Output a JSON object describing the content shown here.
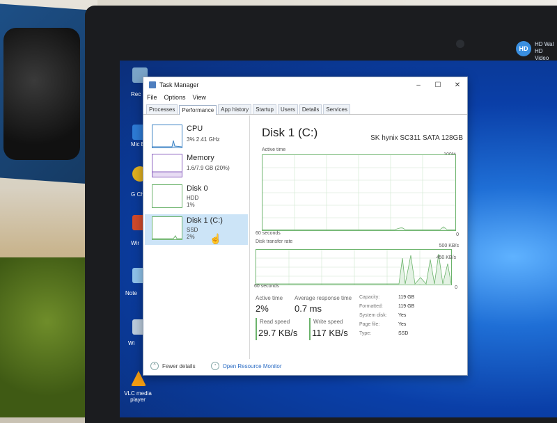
{
  "desktop": {
    "badge": "HD",
    "badge_text": "HD Wal HD Video",
    "icons": [
      {
        "label": "Rec",
        "color": "#7aa4c8"
      },
      {
        "label": "Mic Ed",
        "color": "#2d7bd6"
      },
      {
        "label": "G Chr",
        "color": "#e0b020"
      },
      {
        "label": "Wir",
        "color": "#d24a2a"
      },
      {
        "label": "Note",
        "color": "#8fc2ea"
      },
      {
        "label": "Wi",
        "color": "#bcd"
      },
      {
        "label": "VLC media player",
        "color": "#f39c12"
      }
    ]
  },
  "window": {
    "title": "Task Manager",
    "controls": {
      "minimize": "–",
      "maximize": "☐",
      "close": "✕"
    },
    "menu": [
      "File",
      "Options",
      "View"
    ],
    "tabs": [
      "Processes",
      "Performance",
      "App history",
      "Startup",
      "Users",
      "Details",
      "Services"
    ],
    "active_tab": "Performance"
  },
  "resources": [
    {
      "name": "CPU",
      "detail1": "3% 2.41 GHz",
      "detail2": "",
      "selected": false
    },
    {
      "name": "Memory",
      "detail1": "1.6/7.9 GB (20%)",
      "detail2": "",
      "selected": false
    },
    {
      "name": "Disk 0",
      "detail1": "HDD",
      "detail2": "1%",
      "selected": false
    },
    {
      "name": "Disk 1 (C:)",
      "detail1": "SSD",
      "detail2": "2%",
      "selected": true
    }
  ],
  "detail": {
    "title": "Disk 1 (C:)",
    "model": "SK hynix SC311 SATA 128GB",
    "graph1": {
      "label": "Active time",
      "max": "100%",
      "time": "60 seconds",
      "min": "0"
    },
    "graph2": {
      "label": "Disk transfer rate",
      "max": "500 KB/s",
      "secondary": "450 KB/s",
      "time": "60 seconds",
      "min": "0"
    },
    "stats": {
      "active_time_label": "Active time",
      "active_time_value": "2%",
      "response_label": "Average response time",
      "response_value": "0.7 ms",
      "read_label": "Read speed",
      "read_value": "29.7 KB/s",
      "write_label": "Write speed",
      "write_value": "117 KB/s"
    },
    "properties": [
      {
        "key": "Capacity:",
        "value": "119 GB"
      },
      {
        "key": "Formatted:",
        "value": "119 GB"
      },
      {
        "key": "System disk:",
        "value": "Yes"
      },
      {
        "key": "Page file:",
        "value": "Yes"
      },
      {
        "key": "Type:",
        "value": "SSD"
      }
    ]
  },
  "footer": {
    "fewer_details": "Fewer details",
    "open_monitor": "Open Resource Monitor"
  }
}
